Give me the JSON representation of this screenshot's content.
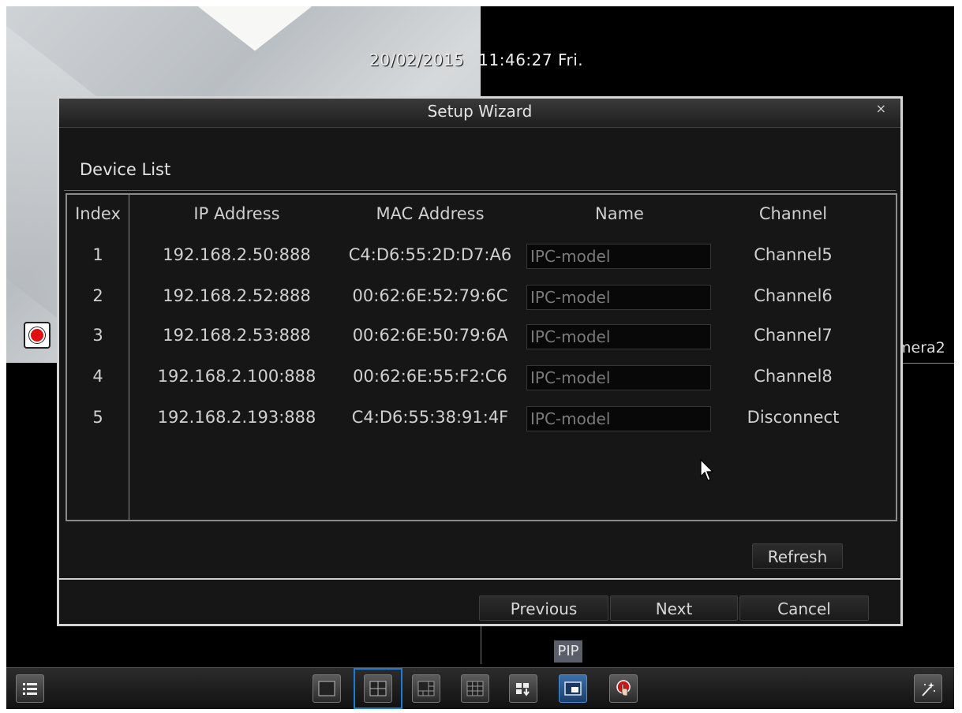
{
  "osd": {
    "date": "20/02/2015",
    "time": "11:46:27 Fri.",
    "camera_name_partial": "mera2",
    "pip_label": "PIP"
  },
  "dialog": {
    "title": "Setup Wizard",
    "close_glyph": "×",
    "section_title": "Device List",
    "columns": [
      "Index",
      "IP Address",
      "MAC Address",
      "Name",
      "Channel"
    ],
    "rows": [
      {
        "index": "1",
        "ip": "192.168.2.50:888",
        "mac": "C4:D6:55:2D:D7:A6",
        "name": "IPC-model",
        "channel": "Channel5"
      },
      {
        "index": "2",
        "ip": "192.168.2.52:888",
        "mac": "00:62:6E:52:79:6C",
        "name": "IPC-model",
        "channel": "Channel6"
      },
      {
        "index": "3",
        "ip": "192.168.2.53:888",
        "mac": "00:62:6E:50:79:6A",
        "name": "IPC-model",
        "channel": "Channel7"
      },
      {
        "index": "4",
        "ip": "192.168.2.100:888",
        "mac": "00:62:6E:55:F2:C6",
        "name": "IPC-model",
        "channel": "Channel8"
      },
      {
        "index": "5",
        "ip": "192.168.2.193:888",
        "mac": "C4:D6:55:38:91:4F",
        "name": "IPC-model",
        "channel": "Disconnect"
      }
    ],
    "buttons": {
      "refresh": "Refresh",
      "previous": "Previous",
      "next": "Next",
      "cancel": "Cancel"
    }
  },
  "taskbar": {
    "icons": [
      "menu-icon",
      "layout-1-icon",
      "layout-4-icon",
      "layout-6-icon",
      "layout-9-icon",
      "sequence-icon",
      "pip-icon",
      "manual-record-icon",
      "wizard-icon"
    ],
    "selected_layout": "layout-4-icon"
  },
  "colors": {
    "dialog_border": "#d4d4d4",
    "selection": "#1e7bd6",
    "record_red": "#e01010"
  }
}
